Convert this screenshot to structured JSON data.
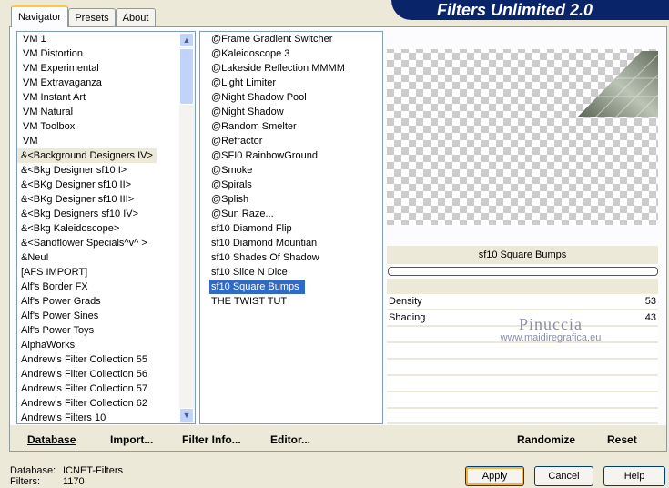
{
  "title": "Filters Unlimited 2.0",
  "tabs": [
    {
      "label": "Navigator",
      "active": true
    },
    {
      "label": "Presets",
      "active": false
    },
    {
      "label": "About",
      "active": false
    }
  ],
  "categories": [
    "VM 1",
    "VM Distortion",
    "VM Experimental",
    "VM Extravaganza",
    "VM Instant Art",
    "VM Natural",
    "VM Toolbox",
    "VM",
    "&<Background Designers IV>",
    "&<Bkg Designer sf10 I>",
    "&<BKg Designer sf10 II>",
    "&<BKg Designer sf10 III>",
    "&<Bkg Designers sf10 IV>",
    "&<Bkg Kaleidoscope>",
    "&<Sandflower Specials^v^ >",
    "&Neu!",
    "[AFS IMPORT]",
    "Alf's Border FX",
    "Alf's Power Grads",
    "Alf's Power Sines",
    "Alf's Power Toys",
    "AlphaWorks",
    "Andrew's Filter Collection 55",
    "Andrew's Filter Collection 56",
    "Andrew's Filter Collection 57",
    "Andrew's Filter Collection 62",
    "Andrew's Filters 10"
  ],
  "filters": [
    "@Frame Gradient Switcher",
    "@Kaleidoscope 3",
    "@Lakeside Reflection MMMM",
    "@Light Limiter",
    "@Night Shadow Pool",
    "@Night Shadow",
    "@Random Smelter",
    "@Refractor",
    "@SFI0 RainbowGround",
    "@Smoke",
    "@Spirals",
    "@Splish",
    "@Sun Raze...",
    "sf10 Diamond Flip",
    "sf10 Diamond Mountian",
    "sf10 Shades Of Shadow",
    "sf10 Slice N Dice",
    "sf10 Square Bumps",
    "THE TWIST TUT"
  ],
  "selected_filter_name": "sf10 Square Bumps",
  "params": [
    {
      "label": "Density",
      "value": "53"
    },
    {
      "label": "Shading",
      "value": "43"
    }
  ],
  "watermark": {
    "line1": "Pinuccia",
    "line2": "www.maidiregrafica.eu"
  },
  "bottom_buttons": {
    "database": "Database",
    "import": "Import...",
    "filter_info": "Filter Info...",
    "editor": "Editor...",
    "randomize": "Randomize",
    "reset": "Reset"
  },
  "status": {
    "database_label": "Database:",
    "database_value": "ICNET-Filters",
    "filters_label": "Filters:",
    "filters_value": "1170"
  },
  "dialog_buttons": {
    "apply": "Apply",
    "cancel": "Cancel",
    "help": "Help"
  },
  "colors": {
    "title_bg": "#0a246a",
    "selection": "#316ac5",
    "face": "#ece9d8"
  }
}
